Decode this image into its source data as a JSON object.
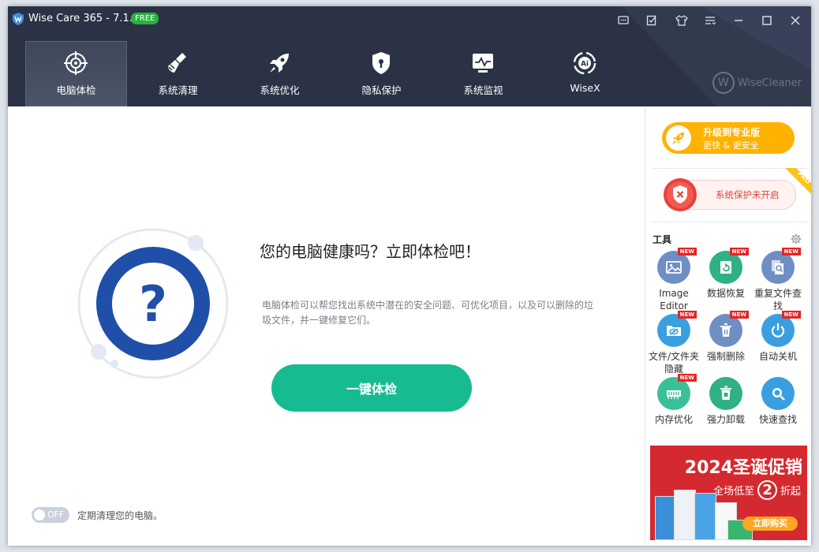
{
  "window": {
    "title": "Wise Care 365 - 7.1.0",
    "badge": "FREE",
    "title_icons": [
      "feedback-icon",
      "notes-icon",
      "skin-icon",
      "menu-icon"
    ],
    "window_controls": [
      "minimize-icon",
      "maximize-icon",
      "close-icon"
    ]
  },
  "nav": {
    "tabs": [
      {
        "label": "电脑体检",
        "icon": "target-icon",
        "active": true
      },
      {
        "label": "系统清理",
        "icon": "broom-icon",
        "active": false
      },
      {
        "label": "系统优化",
        "icon": "rocket-icon",
        "active": false
      },
      {
        "label": "隐私保护",
        "icon": "shield-lock-icon",
        "active": false
      },
      {
        "label": "系统监视",
        "icon": "monitor-icon",
        "active": false
      },
      {
        "label": "WiseX",
        "icon": "ai-icon",
        "active": false
      }
    ],
    "brand": "WiseCleaner",
    "brand_mark": "W"
  },
  "main": {
    "question_mark": "?",
    "headline": "您的电脑健康吗？立即体检吧！",
    "description": "电脑体检可以帮您找出系统中潜在的安全问题、可优化项目，以及可以删除的垃圾文件，并一键修复它们。",
    "scan_button": "一键体检",
    "toggle_state": "OFF",
    "toggle_label": "定期清理您的电脑。"
  },
  "side": {
    "upgrade_line1": "升级到专业版",
    "upgrade_line2": "更快 & 更安全",
    "protection_status": "系统保护未开启",
    "pro_ribbon": "PRO",
    "tools_title": "工具",
    "tools": [
      {
        "label": "Image Editor",
        "icon": "image-icon",
        "new": true,
        "color": "#6e8fc4"
      },
      {
        "label": "数据恢复",
        "icon": "recover-icon",
        "new": true,
        "color": "#2fb182"
      },
      {
        "label": "重复文件查找",
        "icon": "duplicate-icon",
        "new": true,
        "color": "#6e8fc4"
      },
      {
        "label": "文件/文件夹隐藏",
        "icon": "hide-folder-icon",
        "new": true,
        "color": "#3a9fe0"
      },
      {
        "label": "强制删除",
        "icon": "trash-icon",
        "new": true,
        "color": "#6e8fc4"
      },
      {
        "label": "自动关机",
        "icon": "power-icon",
        "new": true,
        "color": "#3a9fe0"
      },
      {
        "label": "内存优化",
        "icon": "ram-icon",
        "new": true,
        "color": "#3bbf9a"
      },
      {
        "label": "强力卸载",
        "icon": "uninstall-icon",
        "new": false,
        "color": "#2fb182"
      },
      {
        "label": "快速查找",
        "icon": "search-icon",
        "new": false,
        "color": "#3a9fe0"
      }
    ],
    "new_badge": "NEW",
    "ad": {
      "title": "2024圣诞促销",
      "sub_prefix": "全场低至",
      "sub_number": "2",
      "sub_suffix": "折起",
      "button": "立即购买"
    }
  },
  "colors": {
    "header_bg": "#2b3245",
    "accent_green": "#16bb92",
    "upgrade_yellow": "#ffb200",
    "check_blue": "#1f4fa8"
  }
}
